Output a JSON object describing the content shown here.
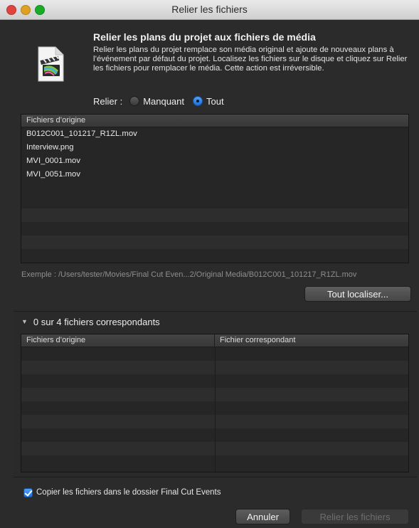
{
  "window": {
    "title": "Relier les fichiers"
  },
  "header": {
    "heading": "Relier les plans du projet aux fichiers de média",
    "description": "Relier les plans du projet remplace son média original et ajoute de nouveaux plans à l’événement par défaut du projet. Localisez les fichiers sur le disque et cliquez sur Relier les fichiers pour remplacer le média. Cette action est irréversible."
  },
  "relink": {
    "label": "Relier :",
    "options": [
      "Manquant",
      "Tout"
    ],
    "selected": "Tout"
  },
  "originals": {
    "header": "Fichiers d’origine",
    "files": [
      "B012C001_101217_R1ZL.mov",
      "Interview.png",
      "MVI_0001.mov",
      "MVI_0051.mov"
    ]
  },
  "example": "Exemple : /Users/tester/Movies/Final Cut Even...2/Original Media/B012C001_101217_R1ZL.mov",
  "buttons": {
    "locate_all": "Tout localiser...",
    "cancel": "Annuler",
    "relink_files": "Relier les fichiers"
  },
  "matches": {
    "summary": "0 sur 4 fichiers correspondants",
    "col_original": "Fichiers d’origine",
    "col_match": "Fichier correspondant"
  },
  "copy_option": {
    "label": "Copier les fichiers dans le dossier Final Cut Events",
    "checked": true
  }
}
